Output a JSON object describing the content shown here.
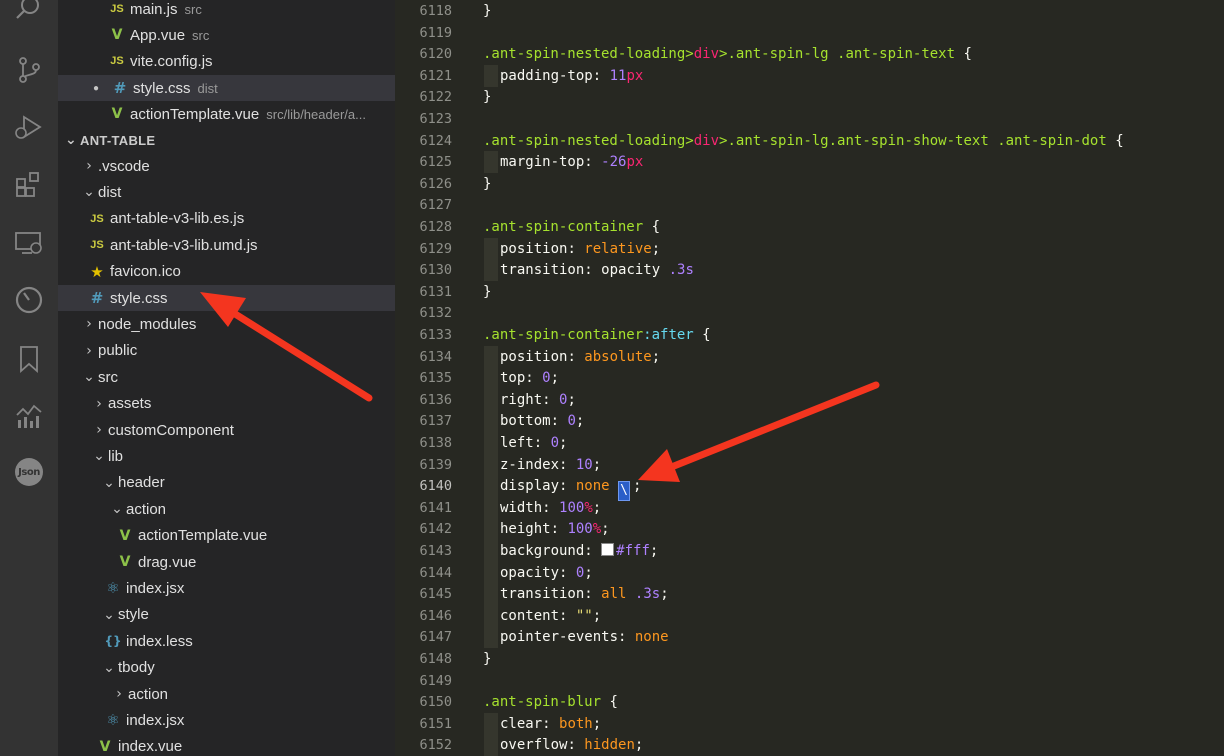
{
  "activity_bar": {
    "items": [
      "search-icon",
      "source-control-icon",
      "run-debug-icon",
      "extensions-icon",
      "remote-explorer-icon",
      "timeline-icon",
      "bookmark-icon",
      "analytics-icon",
      "json-icon"
    ],
    "json_label": "Json"
  },
  "open_editors": [
    {
      "name": "main.js",
      "desc": "src",
      "icon": "js"
    },
    {
      "name": "App.vue",
      "desc": "src",
      "icon": "vue"
    },
    {
      "name": "vite.config.js",
      "desc": "",
      "icon": "js"
    },
    {
      "name": "style.css",
      "desc": "dist",
      "icon": "css",
      "modified": true
    },
    {
      "name": "actionTemplate.vue",
      "desc": "src/lib/header/a...",
      "icon": "vue"
    }
  ],
  "section_title": "ANT-TABLE",
  "tree": [
    {
      "name": ".vscode",
      "chev": "›"
    },
    {
      "name": "dist",
      "chev": "⌄"
    },
    {
      "name": "ant-table-v3-lib.es.js",
      "icon": "js"
    },
    {
      "name": "ant-table-v3-lib.umd.js",
      "icon": "js"
    },
    {
      "name": "favicon.ico",
      "icon": "star"
    },
    {
      "name": "style.css",
      "icon": "css",
      "selected": true
    },
    {
      "name": "node_modules",
      "chev": "›"
    },
    {
      "name": "public",
      "chev": "›"
    },
    {
      "name": "src",
      "chev": "⌄"
    },
    {
      "name": "assets",
      "chev": "›"
    },
    {
      "name": "customComponent",
      "chev": "›"
    },
    {
      "name": "lib",
      "chev": "⌄"
    },
    {
      "name": "header",
      "chev": "⌄"
    },
    {
      "name": "action",
      "chev": "⌄"
    },
    {
      "name": "actionTemplate.vue",
      "icon": "vue"
    },
    {
      "name": "drag.vue",
      "icon": "vue"
    },
    {
      "name": "index.jsx",
      "icon": "react"
    },
    {
      "name": "style",
      "chev": "⌄"
    },
    {
      "name": "index.less",
      "icon": "less"
    },
    {
      "name": "tbody",
      "chev": "⌄"
    },
    {
      "name": "action",
      "chev": "›"
    },
    {
      "name": "index.jsx",
      "icon": "react"
    },
    {
      "name": "index.vue",
      "icon": "vue"
    }
  ],
  "editor": {
    "current_line": "6140",
    "line_numbers": [
      "6118",
      "6119",
      "6120",
      "6121",
      "6122",
      "6123",
      "6124",
      "6125",
      "6126",
      "6127",
      "6128",
      "6129",
      "6130",
      "6131",
      "6132",
      "6133",
      "6134",
      "6135",
      "6136",
      "6137",
      "6138",
      "6139",
      "6140",
      "6141",
      "6142",
      "6143",
      "6144",
      "6145",
      "6146",
      "6147",
      "6148",
      "6149",
      "6150",
      "6151",
      "6152"
    ],
    "tokens": {
      "s1_a": ".ant-spin-nested-loading",
      "gt": ">",
      "div": "div",
      "s1_b": ".ant-spin-lg .ant-spin-text",
      "brace_open": " {",
      "brace_close": "}",
      "padding_top": "padding-top",
      "colon": ": ",
      "v11": "11",
      "px": "px",
      "s2_b": ".ant-spin-lg.ant-spin-show-text .ant-spin-dot",
      "margin_top": "margin-top",
      "v_26": "-26",
      "s3": ".ant-spin-container",
      "position": "position",
      "relative": "relative",
      "semi": ";",
      "transition": "transition",
      "opacity_kw": "opacity",
      "v_3s": ".3s",
      "after": ":after",
      "absolute": "absolute",
      "top": "top",
      "right": "right",
      "bottom": "bottom",
      "left": "left",
      "zero": "0",
      "z_index": "z-index",
      "v10": "10",
      "display": "display",
      "none": "none",
      "cursor_text": "\\",
      "width": "width",
      "height": "height",
      "v100": "100",
      "pct": "%",
      "background": "background",
      "fff": "#fff",
      "opacity": "opacity",
      "all": "all",
      "content": "content",
      "empty_str": "\"\"",
      "pointer_events": "pointer-events",
      "s4": ".ant-spin-blur",
      "clear": "clear",
      "both": "both",
      "overflow": "overflow",
      "hidden": "hidden"
    }
  },
  "colors": {
    "annotation_arrow": "#f4351f",
    "editor_bg": "#272822",
    "sidebar_bg": "#252526"
  }
}
